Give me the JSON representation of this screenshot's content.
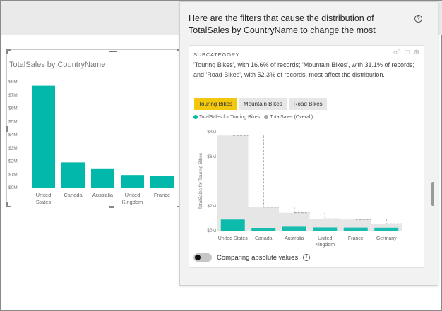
{
  "visual": {
    "title": "TotalSales by CountryName",
    "chart_data": {
      "type": "bar",
      "title": "TotalSales by CountryName",
      "categories": [
        "United States",
        "Canada",
        "Australia",
        "United Kingdom",
        "France"
      ],
      "category_lines": [
        [
          "United",
          "States"
        ],
        [
          "Canada"
        ],
        [
          "Australia"
        ],
        [
          "United",
          "Kingdom"
        ],
        [
          "France"
        ]
      ],
      "values": [
        7.7,
        1.9,
        1.45,
        0.95,
        0.9
      ],
      "yticks": [
        "$0M",
        "$1M",
        "$2M",
        "$3M",
        "$4M",
        "$5M",
        "$6M",
        "$7M",
        "$8M"
      ],
      "ylim": [
        0,
        8
      ],
      "color": "#01b8aa"
    }
  },
  "popup": {
    "title": "Here are the filters that cause the distribution of TotalSales by CountryName to change the most",
    "help_icon": "?",
    "card": {
      "label": "SUBCATEGORY",
      "actions": [
        "thumbs-up-icon",
        "comment-icon",
        "add-icon"
      ],
      "text": "'Touring Bikes', with 16.6% of records; 'Mountain Bikes', with 31.1% of records; and 'Road Bikes', with 52.3% of records, most affect the distribution.",
      "buttons": [
        {
          "label": "Touring Bikes",
          "active": true
        },
        {
          "label": "Mountain Bikes",
          "active": false
        },
        {
          "label": "Road Bikes",
          "active": false
        }
      ],
      "legend": [
        {
          "label": "TotalSales for Touring Bikes",
          "color": "#01b8aa"
        },
        {
          "label": "TotalSales (Overall)",
          "color": "#a6a6a6"
        }
      ],
      "chart_data": {
        "type": "bar",
        "categories": [
          "United States",
          "Canada",
          "Australia",
          "United Kingdom",
          "France",
          "Germany"
        ],
        "category_lines": [
          [
            "United States"
          ],
          [
            "Canada"
          ],
          [
            "Australia"
          ],
          [
            "United",
            "Kingdom"
          ],
          [
            "France"
          ],
          [
            "Germany"
          ]
        ],
        "series": [
          {
            "name": "TotalSales for Touring Bikes",
            "values": [
              0.9,
              0.22,
              0.32,
              0.26,
              0.25,
              0.24
            ]
          },
          {
            "name": "TotalSales (Overall)",
            "values": [
              7.7,
              1.9,
              1.45,
              0.95,
              0.9,
              0.55
            ]
          }
        ],
        "ylabel": "TotalSales for Touring Bikes",
        "yticks": [
          "$0M",
          "$2M",
          "$6M",
          "$8M"
        ],
        "ytick_values": [
          0,
          2,
          6,
          8
        ],
        "ylim": [
          0,
          8
        ]
      },
      "toggle_label": "Comparing absolute values",
      "info_icon": "i"
    }
  }
}
